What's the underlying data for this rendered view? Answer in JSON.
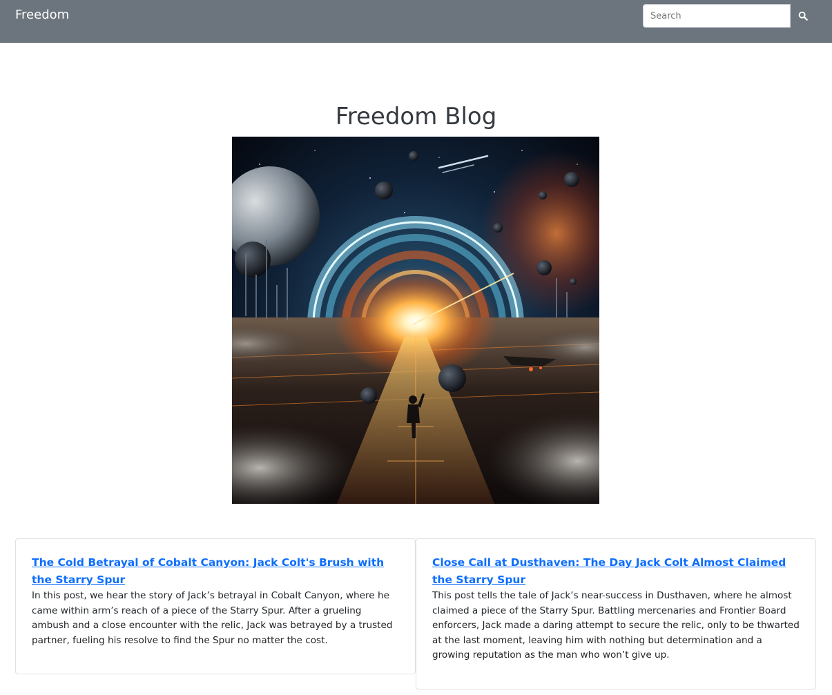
{
  "navbar": {
    "brand": "Freedom",
    "search": {
      "placeholder": "Search",
      "value": ""
    },
    "search_icon": "search-icon"
  },
  "page": {
    "title": "Freedom Blog",
    "hero_image": "space-gate-traveler-illustration"
  },
  "posts": [
    {
      "title": "The Cold Betrayal of Cobalt Canyon: Jack Colt's Brush with the Starry Spur",
      "summary": "In this post, we hear the story of Jack’s betrayal in Cobalt Canyon, where he came within arm’s reach of a piece of the Starry Spur. After a grueling ambush and a close encounter with the relic, Jack was betrayed by a trusted partner, fueling his resolve to find the Spur no matter the cost."
    },
    {
      "title": "Close Call at Dusthaven: The Day Jack Colt Almost Claimed the Starry Spur",
      "summary": "This post tells the tale of Jack’s near-success in Dusthaven, where he almost claimed a piece of the Starry Spur. Battling mercenaries and Frontier Board enforcers, Jack made a daring attempt to secure the relic, only to be thwarted at the last moment, leaving him with nothing but determination and a growing reputation as the man who won’t give up."
    }
  ],
  "colors": {
    "navbar": "#6c757d",
    "link": "#0d6efd",
    "title": "#343a40"
  }
}
